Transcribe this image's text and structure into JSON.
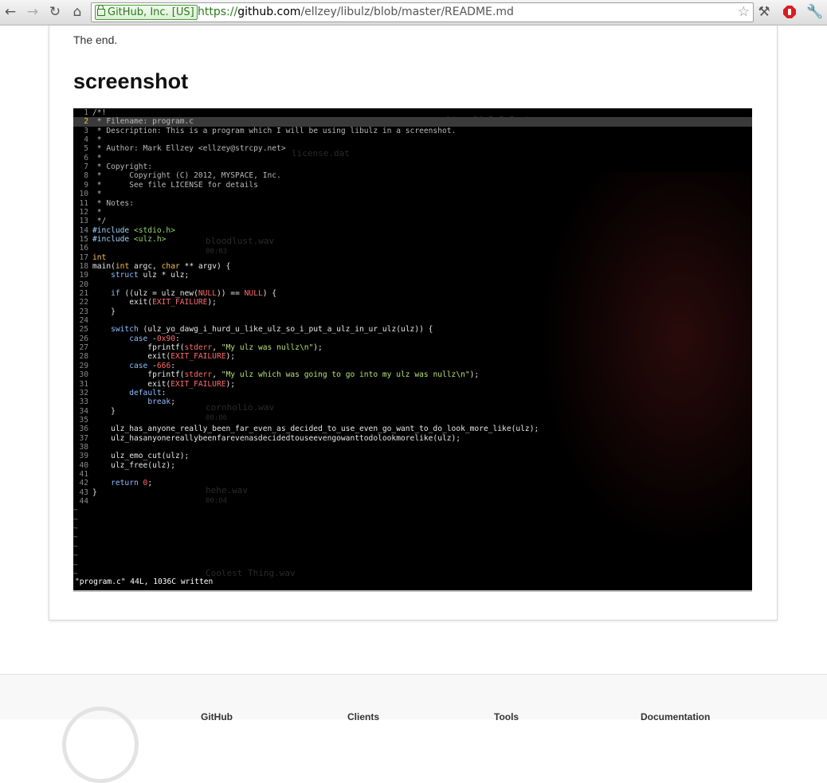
{
  "browser": {
    "ev_label": "GitHub, Inc. [US]",
    "url_scheme": "https://",
    "url_host": "github.com",
    "url_path": "/ellzey/libulz/blob/master/README.md"
  },
  "readme": {
    "intro_text": "The end.",
    "heading": "screenshot"
  },
  "terminal": {
    "status_line": "\"program.c\" 44L, 1036C written",
    "ghost_files": [
      {
        "name": "license.dat",
        "meta": ""
      },
      {
        "name": "linux64-5.5.3.sh",
        "meta": ""
      },
      {
        "name": "bloodlust.wav",
        "meta": "00:03"
      },
      {
        "name": "cornholio.wav",
        "meta": "00:06"
      },
      {
        "name": "hehe.wav",
        "meta": "00:04"
      },
      {
        "name": "Coolest Thing.wav",
        "meta": ""
      }
    ]
  },
  "footer": {
    "columns": [
      "GitHub",
      "Clients",
      "Tools",
      "Documentation"
    ]
  }
}
